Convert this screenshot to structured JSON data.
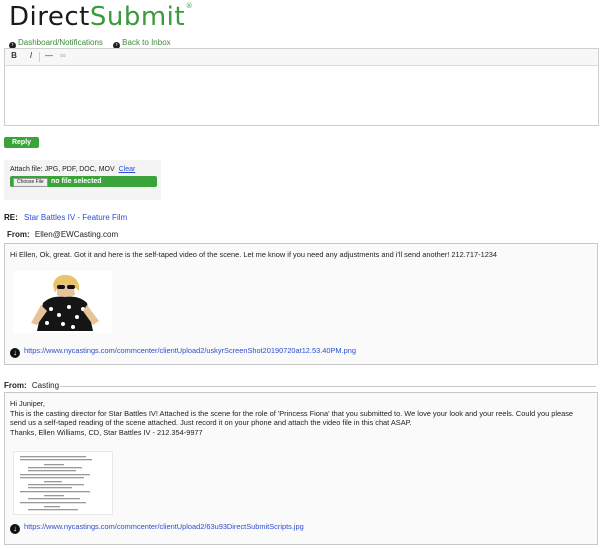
{
  "logo": {
    "part1": "Direct",
    "part2": "Submit",
    "reg": "®"
  },
  "nav": {
    "dashboard": "Dashboard/Notifications",
    "inbox": "Back to Inbox"
  },
  "toolbar": {
    "bold": "B",
    "italic": "I",
    "hr": "—",
    "link": "∞"
  },
  "reply_button": "Reply Now",
  "attach": {
    "label": "Attach file: JPG, PDF, DOC, MOV",
    "clear": "Clear",
    "choose": "Choose File",
    "status": "no file selected"
  },
  "re": {
    "label": "RE:",
    "subject": "Star Battles IV - Feature Film"
  },
  "message1": {
    "from_label": "From:",
    "from_value": "Ellen@EWCasting.com",
    "text": "Hi Ellen, Ok, great. Got it and here is the self-taped video of the scene. Let me know if you need any adjustments and i'll send another! 212.717-1234",
    "link": "https://www.nycastings.com/commcenter/clientUpload2/uskyrScreenShot20190720at12.53.40PM.png"
  },
  "message2": {
    "from_label": "From:",
    "from_value": "Casting",
    "greeting": "Hi Juniper,",
    "text": "This is the casting director for Star Battles IV! Attached is the scene for the role of 'Princess Fiona' that you submitted to. We love your look and your reels. Could you please send us a self-taped reading of the scene attached. Just record it on your phone and attach the video file in this chat ASAP.",
    "signoff": "Thanks, Ellen Williams, CD, Star Battles IV - 212.354-9977",
    "link": "https://www.nycastings.com/commcenter/clientUpload2/63u93DirectSubmitScripts.jpg"
  }
}
